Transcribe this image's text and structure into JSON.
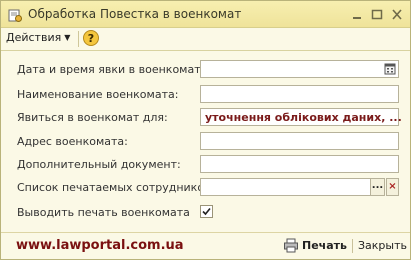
{
  "window": {
    "title": "Обработка  Повестка в военкомат",
    "icon": "form-processing-icon",
    "controls": [
      "minimize-icon",
      "maximize-icon",
      "close-icon"
    ]
  },
  "toolbar": {
    "actions_label": "Действия",
    "help_label": "?"
  },
  "form": {
    "fields": [
      {
        "label": "Дата и время явки в военкомат:",
        "value": "",
        "button": "calendar-icon"
      },
      {
        "label": "Наименование военкомата:",
        "value": ""
      },
      {
        "label": "Явиться в военкомат для:",
        "value": "уточнення облікових даних, ..."
      },
      {
        "label": "Адрес военкомата:",
        "value": ""
      },
      {
        "label": "Дополнительный документ:",
        "value": ""
      },
      {
        "label": "Список печатаемых сотрудников:",
        "value": "",
        "select_button": "...",
        "clear_button": "×"
      },
      {
        "label": "Выводить печать военкомата",
        "checked": true
      }
    ]
  },
  "footer": {
    "watermark": "www.lawportal.com.ua",
    "print_label": "Печать",
    "close_label": "Закрыть"
  },
  "colors": {
    "titlebar": "#efe39a",
    "window_bg": "#fbf9e6",
    "value_text": "#7a1a1a",
    "watermark": "#7a1010"
  }
}
